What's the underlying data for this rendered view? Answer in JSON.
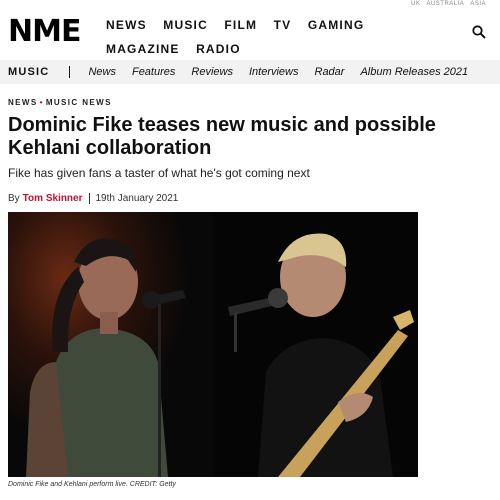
{
  "editions": [
    "UK",
    "AUSTRALIA",
    "ASIA"
  ],
  "header": {
    "logo": "NME",
    "nav": [
      "NEWS",
      "MUSIC",
      "FILM",
      "TV",
      "GAMING",
      "MAGAZINE",
      "RADIO"
    ]
  },
  "subnav": {
    "section": "MUSIC",
    "items": [
      "News",
      "Features",
      "Reviews",
      "Interviews",
      "Radar",
      "Album Releases 2021"
    ]
  },
  "article": {
    "breadcrumb": [
      "NEWS",
      "MUSIC NEWS"
    ],
    "headline": "Dominic Fike teases new music and possible Kehlani collaboration",
    "standfirst": "Fike has given fans a taster of what he's got coming next",
    "by_label": "By",
    "author": "Tom Skinner",
    "date": "19th January 2021",
    "caption": "Dominic Fike and Kehlani perform live. CREDIT: Getty"
  },
  "colors": {
    "accent": "#c8102e",
    "subnav_bg": "#f2f2f2"
  },
  "icons": {
    "search": "search-icon"
  }
}
